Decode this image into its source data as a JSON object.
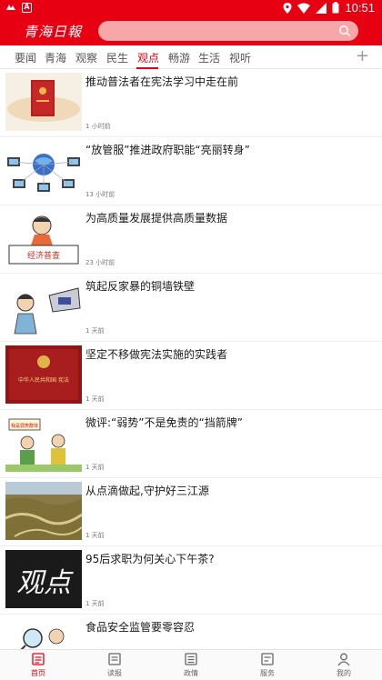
{
  "status_bar": {
    "time": "10:51"
  },
  "header": {
    "logo_text": "青海日報"
  },
  "tabs": [
    {
      "label": "要闻"
    },
    {
      "label": "青海"
    },
    {
      "label": "观察"
    },
    {
      "label": "民生"
    },
    {
      "label": "观点"
    },
    {
      "label": "畅游"
    },
    {
      "label": "生活"
    },
    {
      "label": "视听"
    }
  ],
  "active_tab": "观点",
  "news": [
    {
      "title": "推动普法者在宪法学习中走在前",
      "time": "1 小时前"
    },
    {
      "title": "“放管服”推进政府职能“亮丽转身”",
      "time": "13 小时前"
    },
    {
      "title": "为高质量发展提供高质量数据",
      "time": "23 小时前"
    },
    {
      "title": "筑起反家暴的铜墙铁壁",
      "time": "1 天前"
    },
    {
      "title": "坚定不移做宪法实施的实践者",
      "time": "1 天前"
    },
    {
      "title": "微评:“弱势”不是免责的“挡箭牌”",
      "time": "1 天前"
    },
    {
      "title": "从点滴做起,守护好三江源",
      "time": "1 天前"
    },
    {
      "title": "95后求职为何关心下午茶?",
      "time": "1 天前"
    },
    {
      "title": "食品安全监管要零容忍",
      "time": ""
    }
  ],
  "thumb_texts": {
    "economy_label": "经济普查",
    "book_label": "中华人民共和国 宪法",
    "sign_label": "我是弱势群体",
    "calligraphy": "观点"
  },
  "bottom_nav": [
    {
      "label": "首页",
      "icon": "home-icon"
    },
    {
      "label": "读报",
      "icon": "newspaper-icon"
    },
    {
      "label": "政情",
      "icon": "document-icon"
    },
    {
      "label": "服务",
      "icon": "service-icon"
    },
    {
      "label": "我的",
      "icon": "user-icon"
    }
  ],
  "colors": {
    "brand_red": "#e60012"
  }
}
